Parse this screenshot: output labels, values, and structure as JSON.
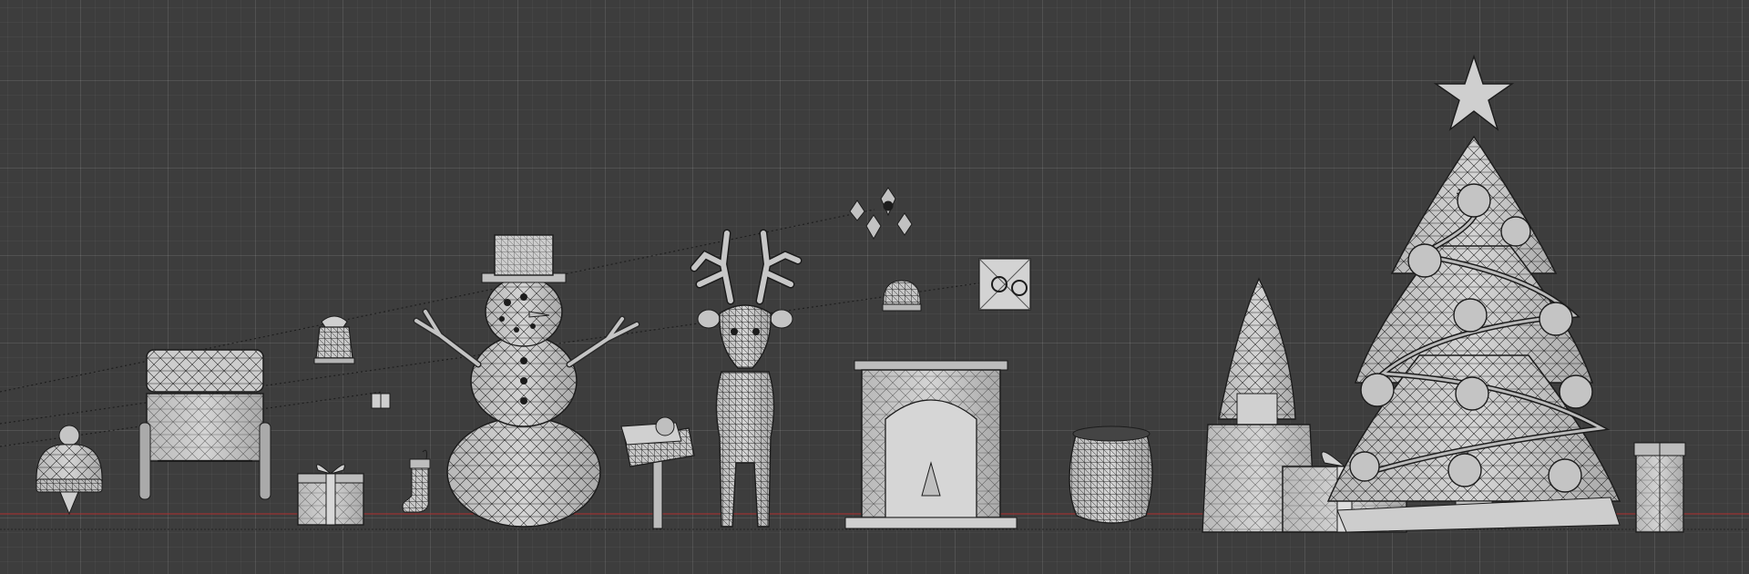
{
  "viewport": {
    "mode": "wireframe-overlay",
    "view": "front-orthographic",
    "background": "#3d3d3d",
    "grid_color": "#555555",
    "floor_axis_color": "#c0392b",
    "mesh_fill": "#c9c9c9",
    "mesh_shade": "#9a9a9a",
    "wire_color": "#1c1c1c"
  },
  "scene_objects": [
    {
      "id": "hat",
      "icon": "beanie-hat-icon"
    },
    {
      "id": "sleigh",
      "icon": "sleigh-icon"
    },
    {
      "id": "bell",
      "icon": "bell-icon"
    },
    {
      "id": "gift-small",
      "icon": "gift-box-icon"
    },
    {
      "id": "stocking",
      "icon": "stocking-icon"
    },
    {
      "id": "snowman",
      "icon": "snowman-icon"
    },
    {
      "id": "signpost",
      "icon": "signpost-icon"
    },
    {
      "id": "reindeer",
      "icon": "reindeer-icon"
    },
    {
      "id": "ornaments",
      "icon": "ornament-icon"
    },
    {
      "id": "beanie-small",
      "icon": "beanie-hat-icon"
    },
    {
      "id": "picture-frame",
      "icon": "wreath-frame-icon"
    },
    {
      "id": "fireplace",
      "icon": "fireplace-icon"
    },
    {
      "id": "sack",
      "icon": "gift-sack-icon"
    },
    {
      "id": "gnome",
      "icon": "gnome-icon"
    },
    {
      "id": "gift-large",
      "icon": "gift-box-icon"
    },
    {
      "id": "christmas-tree",
      "icon": "christmas-tree-icon"
    },
    {
      "id": "gift-tall",
      "icon": "gift-box-icon"
    }
  ]
}
